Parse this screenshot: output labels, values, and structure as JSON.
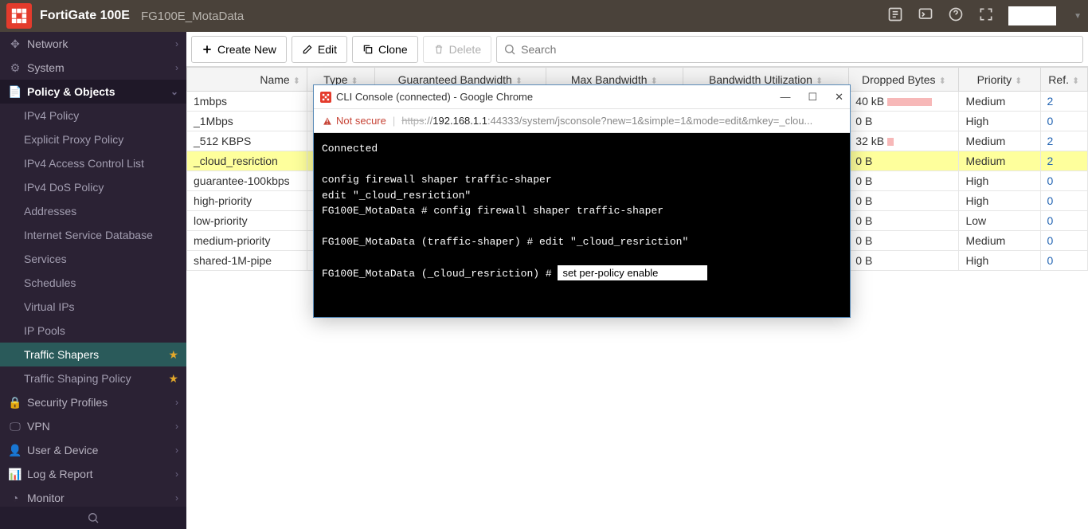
{
  "header": {
    "product": "FortiGate 100E",
    "device": "FG100E_MotaData"
  },
  "sidebar": {
    "sections": [
      {
        "icon": "move",
        "label": "Network",
        "type": "section"
      },
      {
        "icon": "gear",
        "label": "System",
        "type": "section"
      },
      {
        "icon": "doc",
        "label": "Policy & Objects",
        "type": "selected-section"
      },
      {
        "label": "IPv4 Policy",
        "type": "sub"
      },
      {
        "label": "Explicit Proxy Policy",
        "type": "sub"
      },
      {
        "label": "IPv4 Access Control List",
        "type": "sub"
      },
      {
        "label": "IPv4 DoS Policy",
        "type": "sub"
      },
      {
        "label": "Addresses",
        "type": "sub"
      },
      {
        "label": "Internet Service Database",
        "type": "sub"
      },
      {
        "label": "Services",
        "type": "sub"
      },
      {
        "label": "Schedules",
        "type": "sub"
      },
      {
        "label": "Virtual IPs",
        "type": "sub"
      },
      {
        "label": "IP Pools",
        "type": "sub"
      },
      {
        "label": "Traffic Shapers",
        "type": "sub-active",
        "star": true
      },
      {
        "label": "Traffic Shaping Policy",
        "type": "sub",
        "star": true
      },
      {
        "icon": "lock",
        "label": "Security Profiles",
        "type": "section"
      },
      {
        "icon": "monitor",
        "label": "VPN",
        "type": "section"
      },
      {
        "icon": "user",
        "label": "User & Device",
        "type": "section"
      },
      {
        "icon": "chart",
        "label": "Log & Report",
        "type": "section"
      },
      {
        "icon": "dash",
        "label": "Monitor",
        "type": "section"
      }
    ]
  },
  "toolbar": {
    "create": "Create New",
    "edit": "Edit",
    "clone": "Clone",
    "delete": "Delete",
    "search_placeholder": "Search"
  },
  "table": {
    "columns": [
      "Name",
      "Type",
      "Guaranteed Bandwidth",
      "Max Bandwidth",
      "Bandwidth Utilization",
      "Dropped Bytes",
      "Priority",
      "Ref."
    ],
    "rows": [
      {
        "name": "1mbps",
        "dropped": "40 kB",
        "bar": "large",
        "priority": "Medium",
        "ref": "2",
        "hl": false
      },
      {
        "name": "_1Mbps",
        "dropped": "0 B",
        "bar": "",
        "priority": "High",
        "ref": "0",
        "hl": false
      },
      {
        "name": "_512 KBPS",
        "dropped": "32 kB",
        "bar": "small",
        "priority": "Medium",
        "ref": "2",
        "hl": false
      },
      {
        "name": "_cloud_resriction",
        "dropped": "0 B",
        "bar": "",
        "priority": "Medium",
        "ref": "2",
        "hl": true
      },
      {
        "name": "guarantee-100kbps",
        "dropped": "0 B",
        "bar": "",
        "priority": "High",
        "ref": "0",
        "hl": false
      },
      {
        "name": "high-priority",
        "dropped": "0 B",
        "bar": "",
        "priority": "High",
        "ref": "0",
        "hl": false
      },
      {
        "name": "low-priority",
        "dropped": "0 B",
        "bar": "",
        "priority": "Low",
        "ref": "0",
        "hl": false
      },
      {
        "name": "medium-priority",
        "dropped": "0 B",
        "bar": "",
        "priority": "Medium",
        "ref": "0",
        "hl": false
      },
      {
        "name": "shared-1M-pipe",
        "dropped": "0 B",
        "bar": "",
        "priority": "High",
        "ref": "0",
        "hl": false
      }
    ]
  },
  "cli": {
    "title": "CLI Console (connected) - Google Chrome",
    "not_secure": "Not secure",
    "url_scheme": "https",
    "url_host": "192.168.1.1",
    "url_path": ":44333/system/jsconsole?new=1&simple=1&mode=edit&mkey=_clou...",
    "lines": [
      "Connected",
      "",
      "config firewall shaper traffic-shaper",
      "edit \"_cloud_resriction\"",
      "FG100E_MotaData # config firewall shaper traffic-shaper",
      "",
      "FG100E_MotaData (traffic-shaper) # edit \"_cloud_resriction\"",
      "",
      "FG100E_MotaData (_cloud_resriction) # "
    ],
    "input": "set per-policy enable"
  }
}
